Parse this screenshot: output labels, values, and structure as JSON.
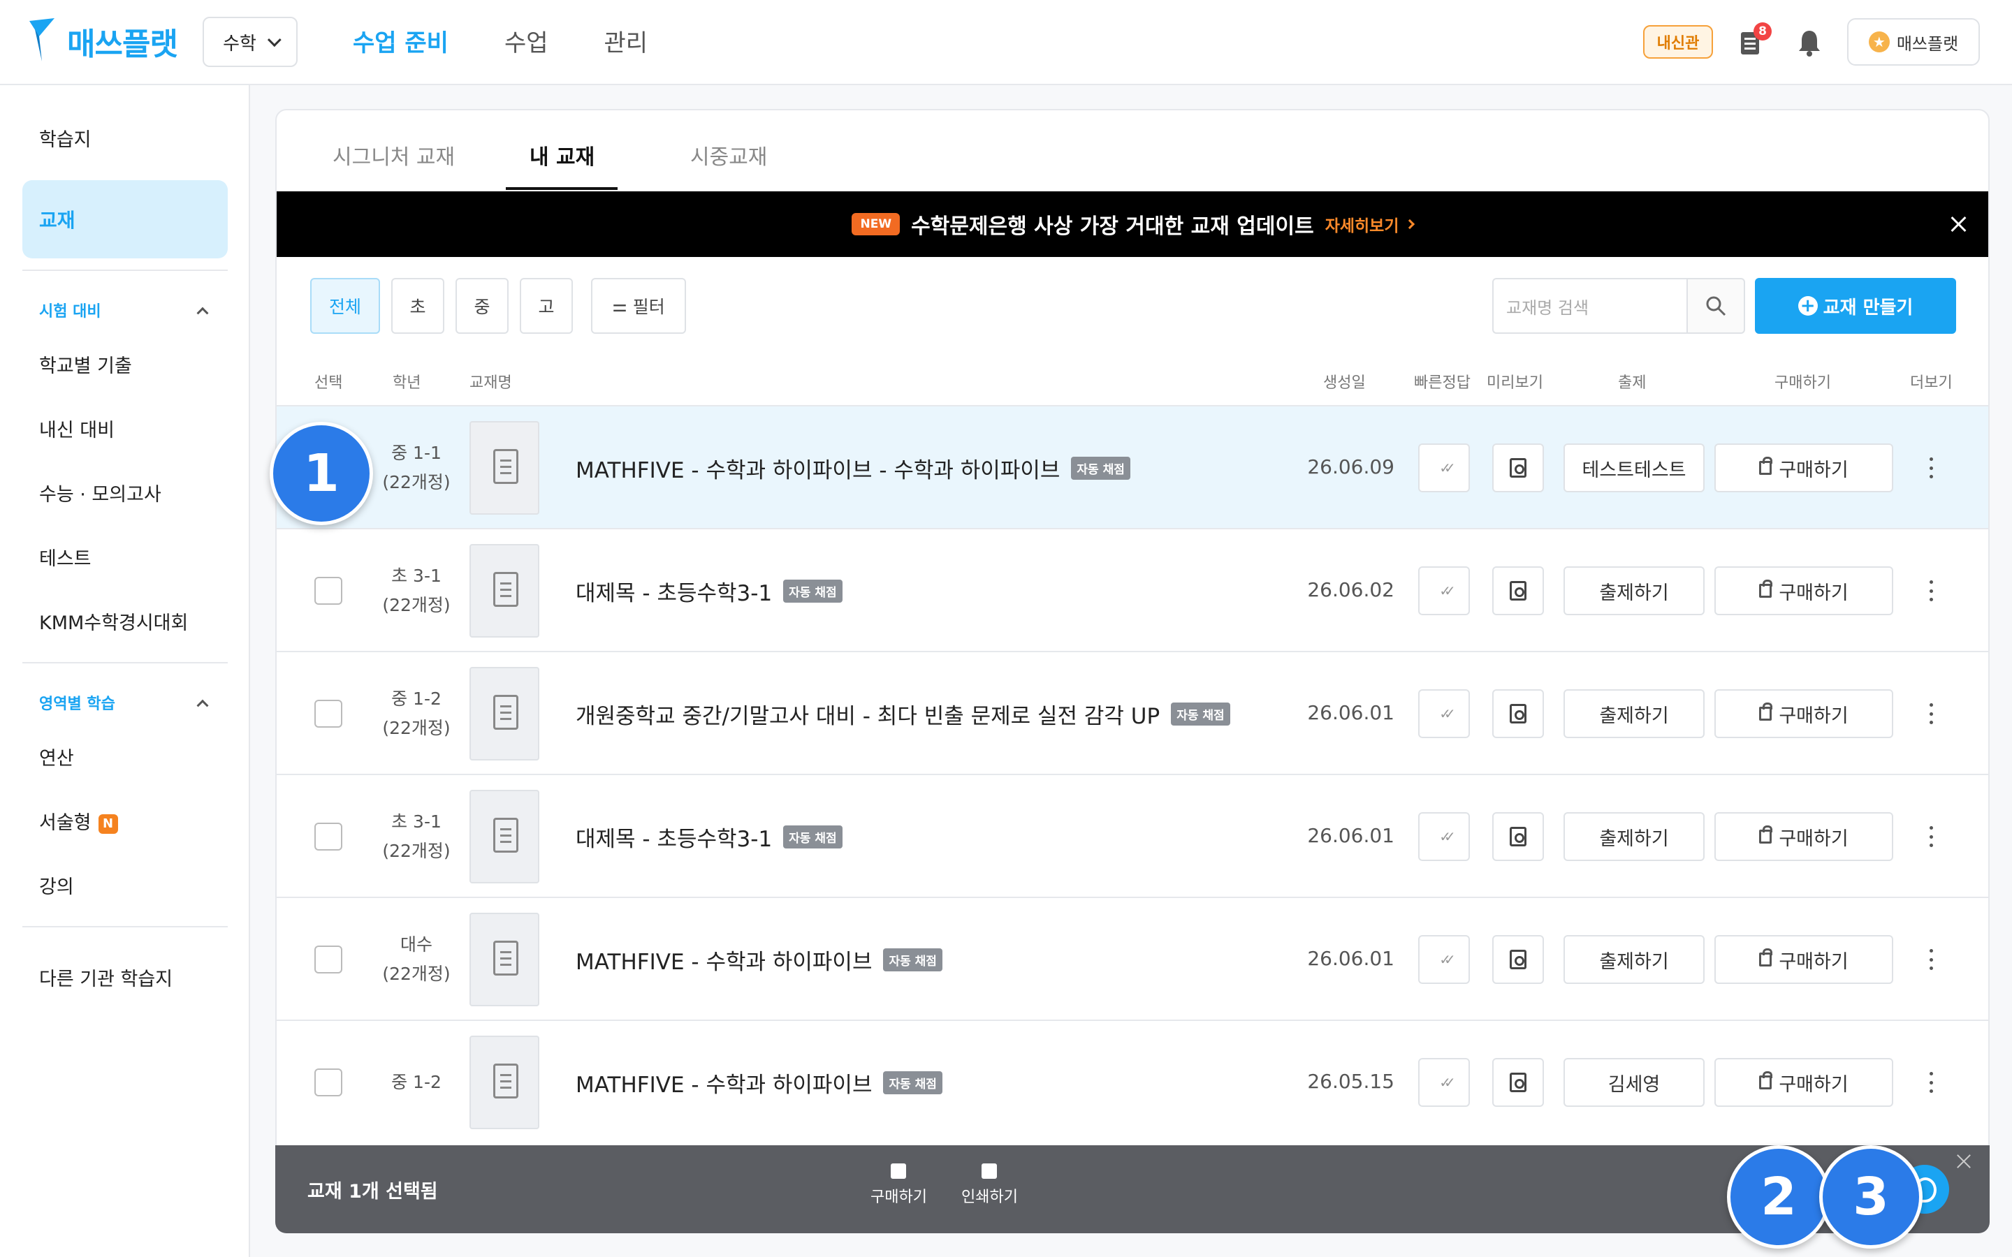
{
  "app": {
    "logo_text": "매쓰플랫",
    "subject": "수학",
    "nav": [
      "수업 준비",
      "수업",
      "관리"
    ],
    "badge_label": "내신관",
    "doc_count": "8",
    "user_label": "매쓰플랫"
  },
  "sidebar": {
    "item_worksheet": "학습지",
    "item_textbook": "교재",
    "group_exam": "시험 대비",
    "exam_items": [
      "학교별 기출",
      "내신 대비",
      "수능 · 모의고사",
      "테스트",
      "KMM수학경시대회"
    ],
    "group_area": "영역별 학습",
    "area_items": [
      "연산",
      "서술형",
      "강의"
    ],
    "new_badge": "N",
    "item_other": "다른 기관 학습지"
  },
  "tabs": [
    "시그니처 교재",
    "내 교재",
    "시중교재"
  ],
  "banner": {
    "new_label": "NEW",
    "text": "수학문제은행 사상 가장 거대한 교재 업데이트",
    "link": "자세히보기"
  },
  "filters": {
    "grades": [
      "전체",
      "초",
      "중",
      "고"
    ],
    "filter_label": "필터",
    "search_placeholder": "교재명 검색",
    "create_label": "교재 만들기"
  },
  "columns": {
    "select": "선택",
    "grade": "학년",
    "name": "교재명",
    "created": "생성일",
    "quick_answer": "빠른정답",
    "preview": "미리보기",
    "assign": "출제",
    "purchase": "구매하기",
    "more": "더보기"
  },
  "rows": [
    {
      "grade1": "중 1-1",
      "grade2": "(22개정)",
      "title": "MATHFIVE - 수학과 하이파이브 - 수학과 하이파이브",
      "tag": "자동 채점",
      "date": "26.06.09",
      "action": "테스트테스트",
      "buy": "구매하기"
    },
    {
      "grade1": "초 3-1",
      "grade2": "(22개정)",
      "title": "대제목 - 초등수학3-1",
      "tag": "자동 채점",
      "date": "26.06.02",
      "action": "출제하기",
      "buy": "구매하기"
    },
    {
      "grade1": "중 1-2",
      "grade2": "(22개정)",
      "title": "개원중학교 중간/기말고사 대비 - 최다 빈출 문제로 실전 감각 UP",
      "tag": "자동 채점",
      "date": "26.06.01",
      "action": "출제하기",
      "buy": "구매하기"
    },
    {
      "grade1": "초 3-1",
      "grade2": "(22개정)",
      "title": "대제목 - 초등수학3-1",
      "tag": "자동 채점",
      "date": "26.06.01",
      "action": "출제하기",
      "buy": "구매하기"
    },
    {
      "grade1": "대수",
      "grade2": "(22개정)",
      "title": "MATHFIVE - 수학과 하이파이브",
      "tag": "자동 채점",
      "date": "26.06.01",
      "action": "출제하기",
      "buy": "구매하기"
    },
    {
      "grade1": "중 1-2",
      "grade2": "",
      "title": "MATHFIVE - 수학과 하이파이브",
      "tag": "자동 채점",
      "date": "26.05.15",
      "action": "김세영",
      "buy": "구매하기"
    }
  ],
  "selection_bar": {
    "label": "교재 1개 선택됨",
    "buy": "구매하기",
    "print": "인쇄하기"
  },
  "markers": [
    "1",
    "2",
    "3"
  ],
  "colors": {
    "accent": "#1aa4f2",
    "marker": "#2b7be8",
    "banner_bg": "#000000",
    "new_orange": "#f26b22"
  }
}
